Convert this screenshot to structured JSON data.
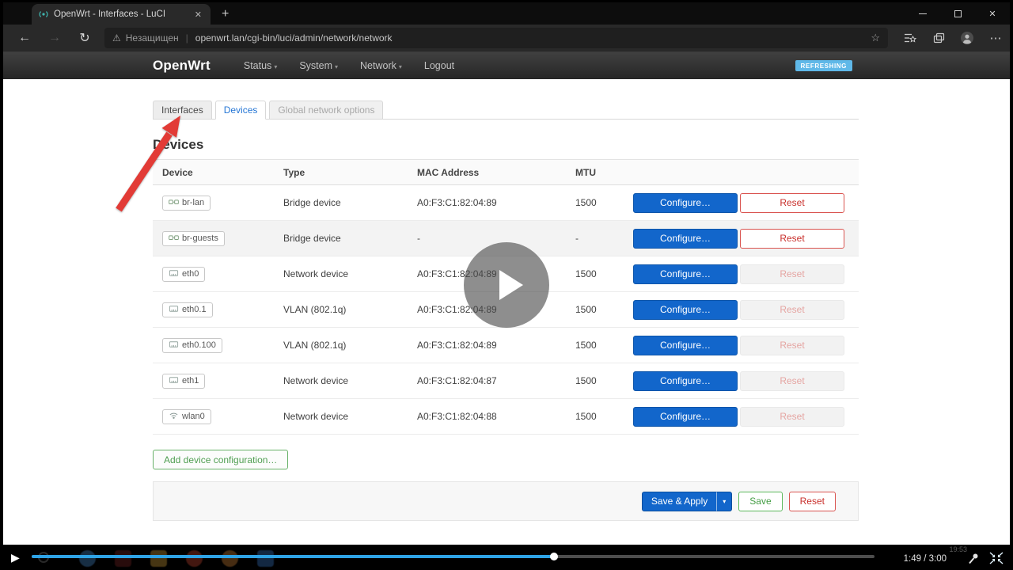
{
  "glyphs": {
    "plus": "+",
    "close": "✕",
    "back": "←",
    "forward": "→",
    "refresh": "↻",
    "warning": "⚠",
    "separator": "|",
    "star": "☆",
    "ellipsis": "⋯",
    "caret_down": "▾",
    "play": "▶"
  },
  "browser": {
    "tab_title": "OpenWrt - Interfaces - LuCI",
    "security_label": "Незащищен",
    "url": "openwrt.lan/cgi-bin/luci/admin/network/network"
  },
  "luci": {
    "brand": "OpenWrt",
    "menu": [
      {
        "label": "Status",
        "caret": true
      },
      {
        "label": "System",
        "caret": true
      },
      {
        "label": "Network",
        "caret": true
      },
      {
        "label": "Logout",
        "caret": false
      }
    ],
    "refresh_badge": "REFRESHING",
    "tabs": [
      {
        "label": "Interfaces",
        "state": "inactive"
      },
      {
        "label": "Devices",
        "state": "active"
      },
      {
        "label": "Global network options",
        "state": "muted"
      }
    ],
    "heading": "Devices",
    "table": {
      "headers": [
        "Device",
        "Type",
        "MAC Address",
        "MTU"
      ],
      "actions": {
        "configure": "Configure…",
        "reset": "Reset"
      },
      "rows": [
        {
          "device": "br-lan",
          "icon": "bridge",
          "type": "Bridge device",
          "mac": "A0:F3:C1:82:04:89",
          "mtu": "1500",
          "shaded": false,
          "reset_muted": false
        },
        {
          "device": "br-guests",
          "icon": "bridge",
          "type": "Bridge device",
          "mac": "-",
          "mtu": "-",
          "shaded": true,
          "reset_muted": false
        },
        {
          "device": "eth0",
          "icon": "port",
          "type": "Network device",
          "mac": "A0:F3:C1:82:04:89",
          "mtu": "1500",
          "shaded": false,
          "reset_muted": true
        },
        {
          "device": "eth0.1",
          "icon": "port",
          "type": "VLAN (802.1q)",
          "mac": "A0:F3:C1:82:04:89",
          "mtu": "1500",
          "shaded": false,
          "reset_muted": true
        },
        {
          "device": "eth0.100",
          "icon": "port",
          "type": "VLAN (802.1q)",
          "mac": "A0:F3:C1:82:04:89",
          "mtu": "1500",
          "shaded": false,
          "reset_muted": true
        },
        {
          "device": "eth1",
          "icon": "port",
          "type": "Network device",
          "mac": "A0:F3:C1:82:04:87",
          "mtu": "1500",
          "shaded": false,
          "reset_muted": true
        },
        {
          "device": "wlan0",
          "icon": "wifi",
          "type": "Network device",
          "mac": "A0:F3:C1:82:04:88",
          "mtu": "1500",
          "shaded": false,
          "reset_muted": true
        }
      ]
    },
    "add_button": "Add device configuration…",
    "footer": {
      "save_apply": "Save & Apply",
      "save": "Save",
      "reset": "Reset"
    }
  },
  "player": {
    "time": "1:49 / 3:00",
    "desktop_clock": "19:53",
    "progress_percent": 62
  }
}
